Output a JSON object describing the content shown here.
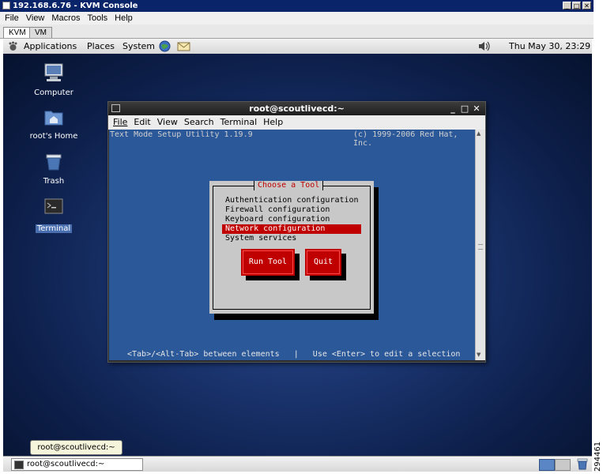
{
  "kvm_window": {
    "title": "192.168.6.76 - KVM Console",
    "menu": [
      "File",
      "View",
      "Macros",
      "Tools",
      "Help"
    ],
    "tabs": [
      {
        "label": "KVM",
        "active": true
      },
      {
        "label": "VM",
        "active": false
      }
    ]
  },
  "panel": {
    "menus": [
      "Applications",
      "Places",
      "System"
    ],
    "clock": "Thu May 30, 23:29",
    "icons": [
      "gnome-foot-icon",
      "browser-globe-icon",
      "mail-icon",
      "volume-icon"
    ]
  },
  "desktop": {
    "icons": [
      {
        "label": "Computer",
        "icon": "computer-icon",
        "selected": false
      },
      {
        "label": "root's Home",
        "icon": "home-folder-icon",
        "selected": false
      },
      {
        "label": "Trash",
        "icon": "trash-icon",
        "selected": false
      },
      {
        "label": "Terminal",
        "icon": "terminal-icon",
        "selected": true
      }
    ]
  },
  "terminal": {
    "title": "root@scoutlivecd:~",
    "menu": [
      "File",
      "Edit",
      "View",
      "Search",
      "Terminal",
      "Help"
    ],
    "header_left": "Text Mode Setup Utility 1.19.9",
    "header_right": "(c) 1999-2006 Red Hat, Inc.",
    "footer": "<Tab>/<Alt-Tab> between elements   |   Use <Enter> to edit a selection",
    "dialog": {
      "title": "Choose a Tool",
      "items": [
        {
          "label": "Authentication configuration",
          "selected": false
        },
        {
          "label": "Firewall configuration",
          "selected": false
        },
        {
          "label": "Keyboard configuration",
          "selected": false
        },
        {
          "label": "Network configuration",
          "selected": true
        },
        {
          "label": "System services",
          "selected": false
        }
      ],
      "run_label": "Run Tool",
      "quit_label": "Quit"
    }
  },
  "taskbar": {
    "task_label": "root@scoutlivecd:~",
    "tooltip": "root@scoutlivecd:~"
  },
  "side_code": "294461",
  "colors": {
    "titlebar": "#0a246a",
    "desktop": "#1b3570",
    "newt_bg": "#2b5899",
    "newt_dialog": "#c8c8c8",
    "newt_select": "#c00000"
  }
}
